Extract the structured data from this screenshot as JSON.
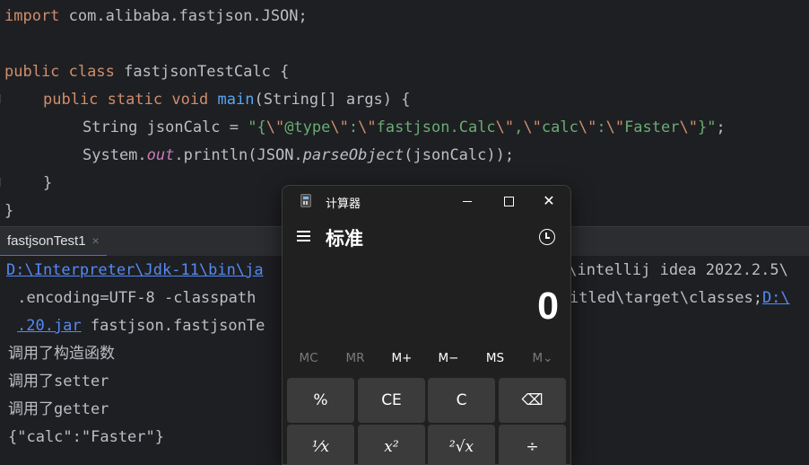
{
  "editor": {
    "import_kw": "import",
    "import_pkg": " com.alibaba.fastjson.JSON;",
    "l3_public": "public",
    "l3_class": "class",
    "l3_name": " fastjsonTestCalc {",
    "l4_public": "public",
    "l4_static": "static",
    "l4_void": "void",
    "l4_main": "main",
    "l4_rest": "(String[] args) {",
    "l5_decl": "String jsonCalc = ",
    "l5_q1": "\"{",
    "l5_e1": "\\\"",
    "l5_s1": "@type",
    "l5_e2": "\\\"",
    "l5_s2": ":",
    "l5_e3": "\\\"",
    "l5_s3": "fastjson.Calc",
    "l5_e4": "\\\"",
    "l5_s4": ",",
    "l5_e5": "\\\"",
    "l5_s5": "calc",
    "l5_e6": "\\\"",
    "l5_s6": ":",
    "l5_e7": "\\\"",
    "l5_s7": "Faster",
    "l5_e8": "\\\"",
    "l5_q2": "}\"",
    "l5_end": ";",
    "l6_sys": "System.",
    "l6_out": "out",
    "l6_println": ".println(JSON.",
    "l6_parse": "parseObject",
    "l6_end": "(jsonCalc));",
    "l7_brace": "}",
    "l8_brace": "}"
  },
  "run_panel": {
    "tab_label": "fastjsonTest1",
    "close_glyph": "×"
  },
  "console": {
    "line1_link": "D:\\Interpreter\\Jdk-11\\bin\\ja",
    "line1_right": "r\\intellij idea 2022.2.5\\",
    "line2_left": " .encoding=UTF-8 -classpath ",
    "line2_right": "itled\\target\\classes;",
    "line2_link": "D:\\",
    "line3_link": ".20.jar",
    "line3_text": " fastjson.fastjsonTe",
    "out1": "调用了构造函数",
    "out2": "调用了setter",
    "out3": "调用了getter",
    "out4": "{\"calc\":\"Faster\"}"
  },
  "calculator": {
    "window_title": "计算器",
    "mode_title": "标准",
    "display_value": "0",
    "memory": [
      "MC",
      "MR",
      "M+",
      "M−",
      "MS",
      "M⌄"
    ],
    "keys_row1": [
      "%",
      "CE",
      "C",
      "⌫"
    ],
    "keys_row2": [
      "¹⁄𝑥",
      "𝑥²",
      "²√𝑥",
      "÷"
    ]
  }
}
